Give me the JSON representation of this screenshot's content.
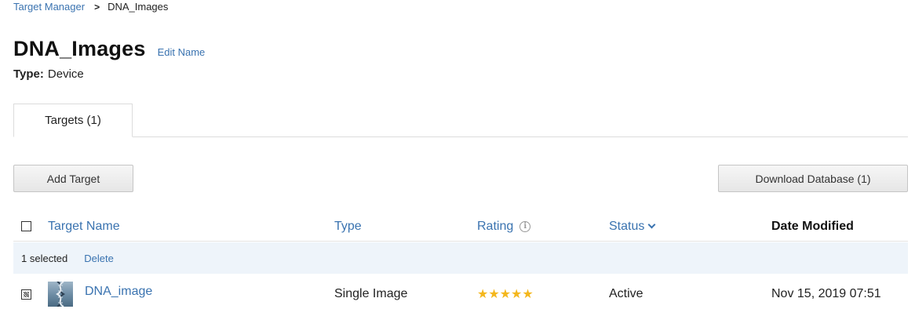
{
  "breadcrumb": {
    "parent": "Target Manager",
    "separator": ">",
    "current": "DNA_Images"
  },
  "page": {
    "title": "DNA_Images",
    "edit_label": "Edit Name",
    "type_label": "Type:",
    "type_value": "Device"
  },
  "tabs": [
    {
      "label": "Targets (1)",
      "active": true
    }
  ],
  "toolbar": {
    "add_label": "Add Target",
    "download_label": "Download Database (1)"
  },
  "table": {
    "headers": {
      "name": "Target Name",
      "type": "Type",
      "rating": "Rating",
      "rating_info_icon": "i",
      "status": "Status",
      "date": "Date Modified"
    },
    "selection": {
      "count_text": "1 selected",
      "delete_label": "Delete"
    },
    "rows": [
      {
        "checked": true,
        "name": "DNA_image",
        "type": "Single Image",
        "rating_stars": 5,
        "rating_display": "★★★★★",
        "status": "Active",
        "date": "Nov 15, 2019 07:51"
      }
    ]
  },
  "colors": {
    "link": "#3a73b0",
    "star": "#f4b71d",
    "selection_bg": "#eef4fa"
  },
  "icons": {
    "breadcrumb_separator": "chevron-right-icon",
    "status_sort": "chevron-down-icon",
    "rating_info": "info-icon"
  }
}
